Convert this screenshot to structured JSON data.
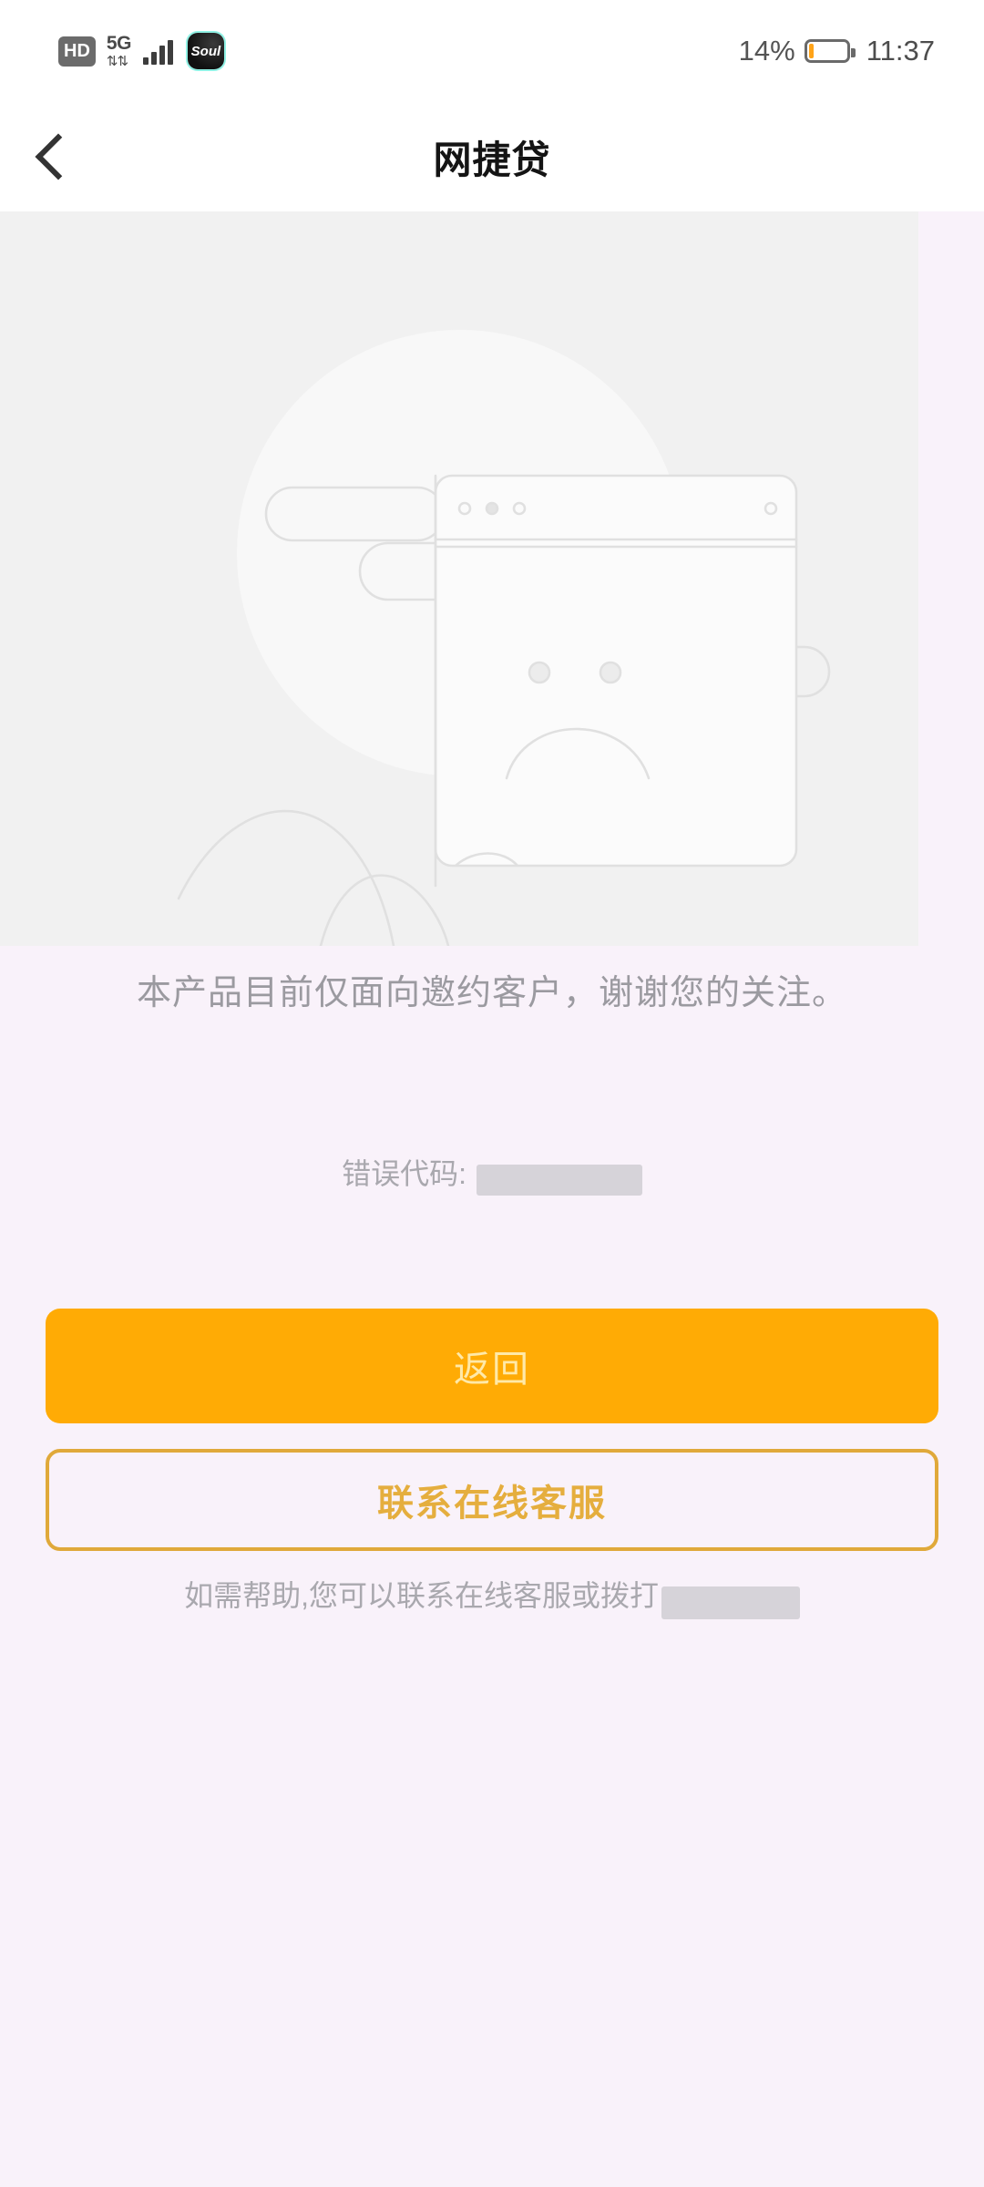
{
  "status_bar": {
    "hd_label": "HD",
    "network_generation": "5G",
    "data_arrows": "⇅",
    "signal_icon": "signal-bars-icon",
    "app_badge_label": "Soul",
    "battery_percent_label": "14%",
    "battery_level": 14,
    "battery_color": "#ffa318",
    "clock": "11:37"
  },
  "app_bar": {
    "back_icon": "chevron-left-icon",
    "title": "网捷贷"
  },
  "illustration": {
    "name": "sad-face-browser-window-illustration",
    "line_color": "#e2e2e2",
    "panel_color": "#f1f1f1"
  },
  "main": {
    "message": "本产品目前仅面向邀约客户，谢谢您的关注。",
    "error_code_label": "错误代码:",
    "error_code_value": "",
    "error_code_redacted": true
  },
  "buttons": {
    "back_label": "返回",
    "back_bg": "#ffab05",
    "back_text_color": "#ffe9a8",
    "contact_label": "联系在线客服",
    "contact_border_color": "#e0a93a",
    "contact_text_color": "#e5ae3e"
  },
  "footer": {
    "help_text": "如需帮助,您可以联系在线客服或拨打",
    "phone_value": "",
    "phone_redacted": true
  }
}
